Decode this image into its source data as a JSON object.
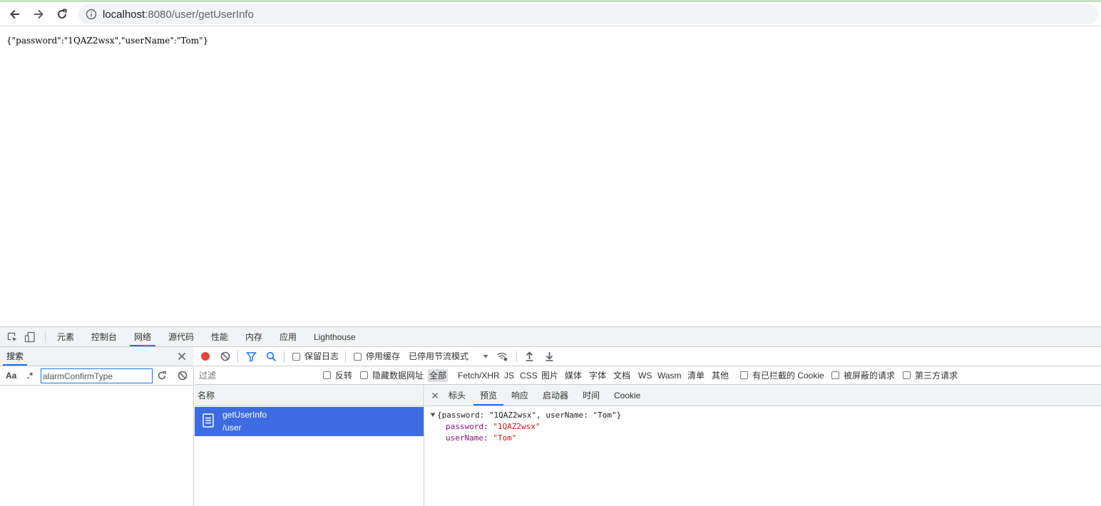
{
  "browser": {
    "back_icon": "arrow-left-icon",
    "forward_icon": "arrow-right-icon",
    "reload_icon": "reload-icon",
    "info_icon": "info-icon",
    "url_host": "localhost",
    "url_rest": ":8080/user/getUserInfo"
  },
  "page": {
    "body_text": "{\"password\":\"1QAZ2wsx\",\"userName\":\"Tom\"}"
  },
  "devtools": {
    "tabs": [
      "元素",
      "控制台",
      "网络",
      "源代码",
      "性能",
      "内存",
      "应用",
      "Lighthouse"
    ],
    "active_tab": "网络",
    "search": {
      "title": "搜索",
      "case_label": "Aa",
      "regex_label": ".*",
      "value": "alarmConfirmType"
    },
    "toolbar": {
      "preserve_log": "保留日志",
      "disable_cache": "停用缓存",
      "throttling": "已停用节流模式"
    },
    "filter": {
      "placeholder": "过滤",
      "invert": "反转",
      "hide_data_urls": "隐藏数据网址",
      "types": [
        "全部",
        "Fetch/XHR",
        "JS",
        "CSS",
        "图片",
        "媒体",
        "字体",
        "文档",
        "WS",
        "Wasm",
        "清单",
        "其他"
      ],
      "active_type": "全部",
      "blocked_cookies": "有已拦截的 Cookie",
      "blocked_requests": "被屏蔽的请求",
      "third_party": "第三方请求"
    },
    "request_list": {
      "header": "名称",
      "rows": [
        {
          "name": "getUserInfo",
          "path": "/user"
        }
      ]
    },
    "detail": {
      "tabs": [
        "标头",
        "预览",
        "响应",
        "启动器",
        "时间",
        "Cookie"
      ],
      "active_tab": "预览",
      "preview": {
        "summary": "{password: \"1QAZ2wsx\", userName: \"Tom\"}",
        "fields": [
          {
            "key": "password",
            "value": "\"1QAZ2wsx\""
          },
          {
            "key": "userName",
            "value": "\"Tom\""
          }
        ]
      }
    },
    "colors": {
      "accent": "#1a73e8",
      "selected_row": "#3d6be2",
      "record": "#e8453c",
      "key": "#881280",
      "string": "#c41a16"
    }
  }
}
